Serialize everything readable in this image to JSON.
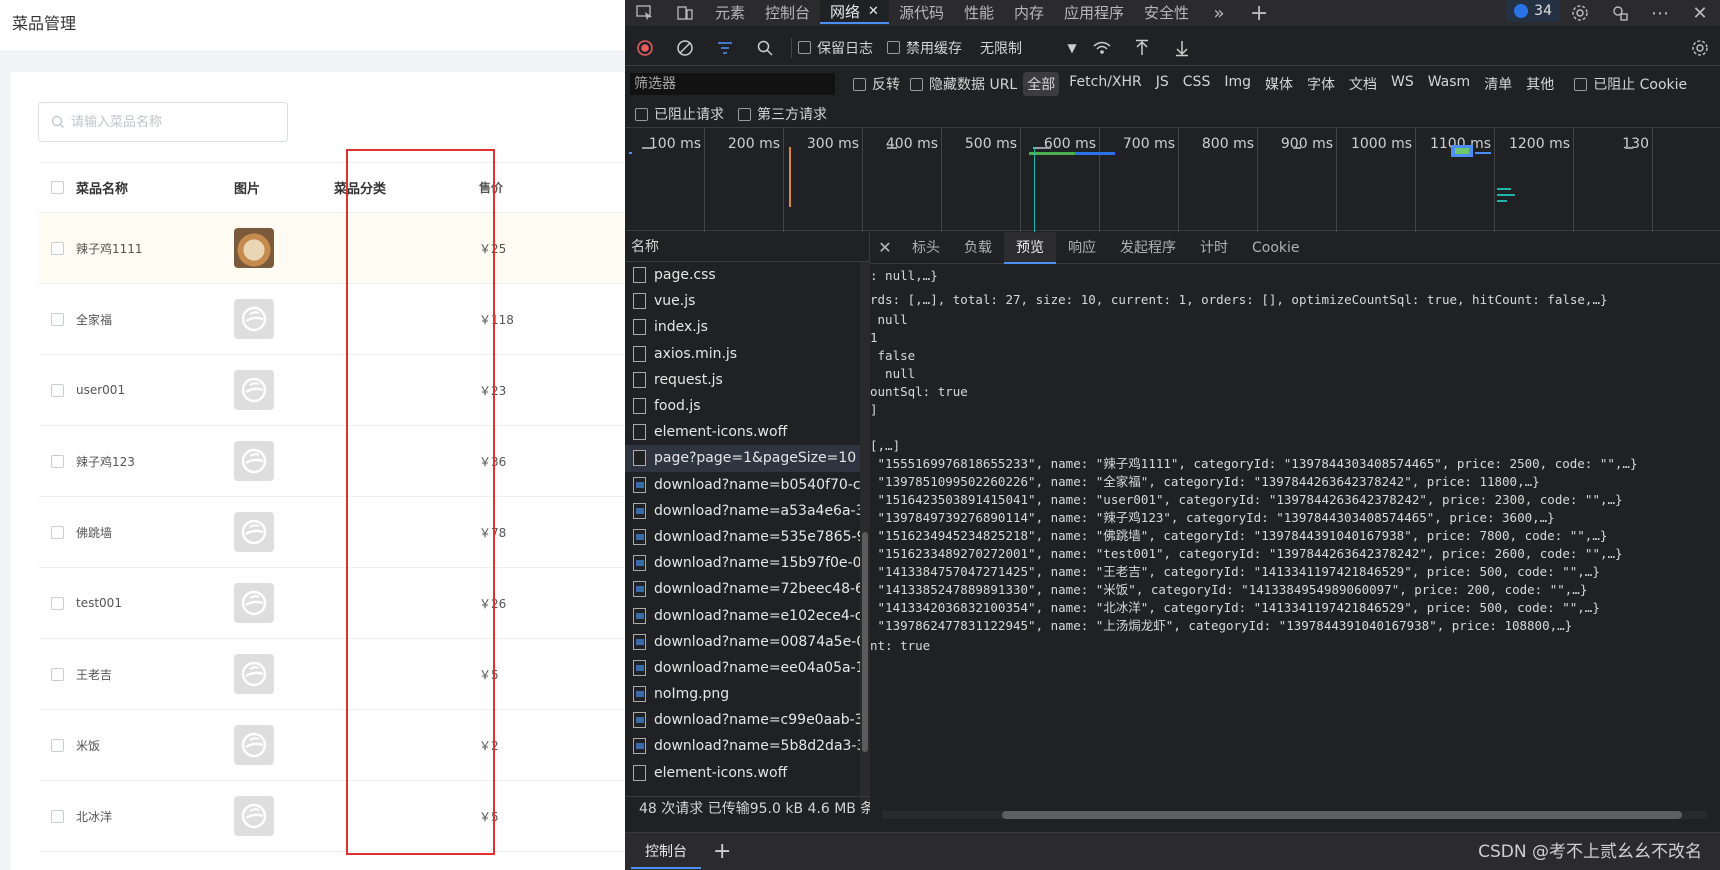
{
  "app": {
    "title": "菜品管理",
    "search_placeholder": "请输入菜品名称",
    "columns": [
      "菜品名称",
      "图片",
      "菜品分类",
      "售价"
    ],
    "rows": [
      {
        "name": "辣子鸡1111",
        "price": "￥25",
        "image": "food-photo"
      },
      {
        "name": "全家福",
        "price": "￥118",
        "image": "placeholder-logo"
      },
      {
        "name": "user001",
        "price": "￥23",
        "image": "placeholder-logo"
      },
      {
        "name": "辣子鸡123",
        "price": "￥36",
        "image": "placeholder-logo"
      },
      {
        "name": "佛跳墙",
        "price": "￥78",
        "image": "placeholder-logo"
      },
      {
        "name": "test001",
        "price": "￥26",
        "image": "placeholder-logo"
      },
      {
        "name": "王老吉",
        "price": "￥5",
        "image": "placeholder-logo"
      },
      {
        "name": "米饭",
        "price": "￥2",
        "image": "placeholder-logo"
      },
      {
        "name": "北冰洋",
        "price": "￥5",
        "image": "placeholder-logo"
      }
    ]
  },
  "devtools": {
    "tabs": [
      {
        "label": "元素"
      },
      {
        "label": "控制台"
      },
      {
        "label": "网络",
        "active": true
      },
      {
        "label": "源代码"
      },
      {
        "label": "性能"
      },
      {
        "label": "内存"
      },
      {
        "label": "应用程序"
      },
      {
        "label": "安全性"
      }
    ],
    "issue_count": "34",
    "toolbar": {
      "preserve_log": "保留日志",
      "disable_cache": "禁用缓存",
      "throttle": "无限制"
    },
    "filter": {
      "placeholder": "筛选器",
      "invert": "反转",
      "hide_data_urls": "隐藏数据 URL",
      "types": [
        "全部",
        "Fetch/XHR",
        "JS",
        "CSS",
        "Img",
        "媒体",
        "字体",
        "文档",
        "WS",
        "Wasm",
        "清单",
        "其他"
      ],
      "active_type": "全部",
      "blocked_cookies": "已阻止 Cookie",
      "blocked_requests": "已阻止请求",
      "third_party": "第三方请求"
    },
    "timeline_ticks": [
      "100 ms",
      "200 ms",
      "300 ms",
      "400 ms",
      "500 ms",
      "600 ms",
      "700 ms",
      "800 ms",
      "900 ms",
      "1000 ms",
      "1100 ms",
      "1200 ms",
      "130"
    ],
    "name_header": "名称",
    "requests": [
      "page.css",
      "vue.js",
      "index.js",
      "axios.min.js",
      "request.js",
      "food.js",
      "element-icons.woff",
      "page?page=1&pageSize=10",
      "download?name=b0540f70-c...",
      "download?name=a53a4e6a-3...",
      "download?name=535e7865-9...",
      "download?name=15b97f0e-0...",
      "download?name=72beec48-6...",
      "download?name=e102ece4-c...",
      "download?name=00874a5e-0...",
      "download?name=ee04a05a-1...",
      "noImg.png",
      "download?name=c99e0aab-3...",
      "download?name=5b8d2da3-3...",
      "element-icons.woff"
    ],
    "selected_request": "page?page=1&pageSize=10",
    "summary": "48 次请求  已传输95.0 kB  4.6 MB 条",
    "detail_tabs": [
      "标头",
      "负载",
      "预览",
      "响应",
      "发起程序",
      "计时",
      "Cookie"
    ],
    "active_detail_tab": "预览",
    "preview_lines": [
      ": null,…}",
      "rds: [,…], total: 27, size: 10, current: 1, orders: [], optimizeCountSql: true, hitCount: false,…}",
      " null",
      "1",
      " false",
      "  null",
      "ountSql: true",
      "]",
      "[,…]",
      " \"1555169976818655233\", name: \"辣子鸡1111\", categoryId: \"1397844303408574465\", price: 2500, code: \"\",…}",
      " \"1397851099502260226\", name: \"全家福\", categoryId: \"1397844263642378242\", price: 11800,…}",
      " \"1516423503891415041\", name: \"user001\", categoryId: \"1397844263642378242\", price: 2300, code: \"\",…}",
      " \"1397849739276890114\", name: \"辣子鸡123\", categoryId: \"1397844303408574465\", price: 3600,…}",
      " \"1516234945234825218\", name: \"佛跳墙\", categoryId: \"1397844391040167938\", price: 7800, code: \"\",…}",
      " \"1516233489270272001\", name: \"test001\", categoryId: \"1397844263642378242\", price: 2600, code: \"\",…}",
      " \"1413384757047271425\", name: \"王老吉\", categoryId: \"1413341197421846529\", price: 500, code: \"\",…}",
      " \"1413385247889891330\", name: \"米饭\", categoryId: \"1413384954989060097\", price: 200, code: \"\",…}",
      " \"1413342036832100354\", name: \"北冰洋\", categoryId: \"1413341197421846529\", price: 500, code: \"\",…}",
      " \"1397862477831122945\", name: \"上汤焗龙虾\", categoryId: \"1397844391040167938\", price: 108800,…}",
      "nt: true"
    ],
    "console_tab": "控制台",
    "watermark": "CSDN @考不上贰幺幺不改名"
  },
  "colors": {
    "accent": "#4c8df6",
    "highlight_box": "#e03131",
    "devtools_bg": "#202124"
  }
}
